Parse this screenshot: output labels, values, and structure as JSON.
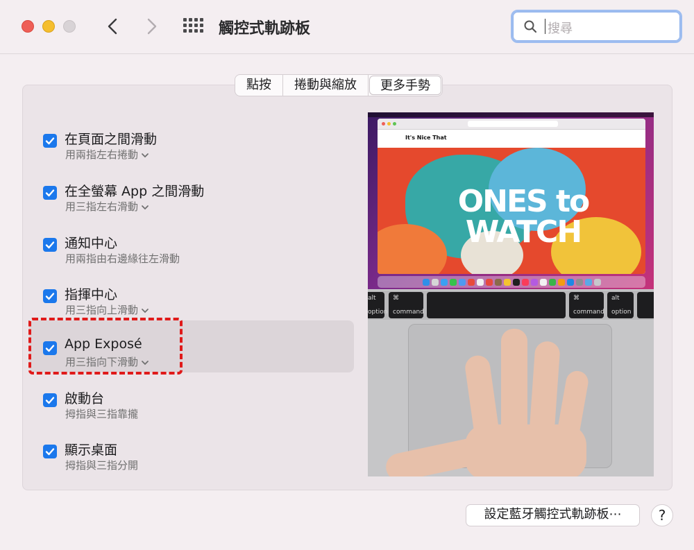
{
  "window": {
    "title": "觸控式軌跡板"
  },
  "search": {
    "placeholder": "搜尋"
  },
  "tabs": [
    {
      "label": "點按",
      "active": false
    },
    {
      "label": "捲動與縮放",
      "active": false
    },
    {
      "label": "更多手勢",
      "active": true
    }
  ],
  "options": [
    {
      "title": "在頁面之間滑動",
      "subtitle": "用兩指左右捲動",
      "has_menu": true,
      "checked": true
    },
    {
      "title": "在全螢幕 App 之間滑動",
      "subtitle": "用三指左右滑動",
      "has_menu": true,
      "checked": true
    },
    {
      "title": "通知中心",
      "subtitle": "用兩指由右邊緣往左滑動",
      "has_menu": false,
      "checked": true
    },
    {
      "title": "指揮中心",
      "subtitle": "用三指向上滑動",
      "has_menu": true,
      "checked": true
    },
    {
      "title": "App Exposé",
      "subtitle": "用三指向下滑動",
      "has_menu": true,
      "checked": true,
      "selected": true
    },
    {
      "title": "啟動台",
      "subtitle": "拇指與三指靠攏",
      "has_menu": false,
      "checked": true
    },
    {
      "title": "顯示桌面",
      "subtitle": "拇指與三指分開",
      "has_menu": false,
      "checked": true
    }
  ],
  "preview": {
    "site_name": "It's Nice That",
    "headline": "ONES to WATCH",
    "keys": {
      "alt": "alt",
      "option": "option",
      "cmd_symbol": "⌘",
      "command": "command"
    }
  },
  "bottom": {
    "bluetooth_button": "設定藍牙觸控式軌跡板⋯",
    "help": "?"
  },
  "colors": {
    "checkbox": "#1b78ec",
    "highlight_dash": "#e01a1a"
  }
}
